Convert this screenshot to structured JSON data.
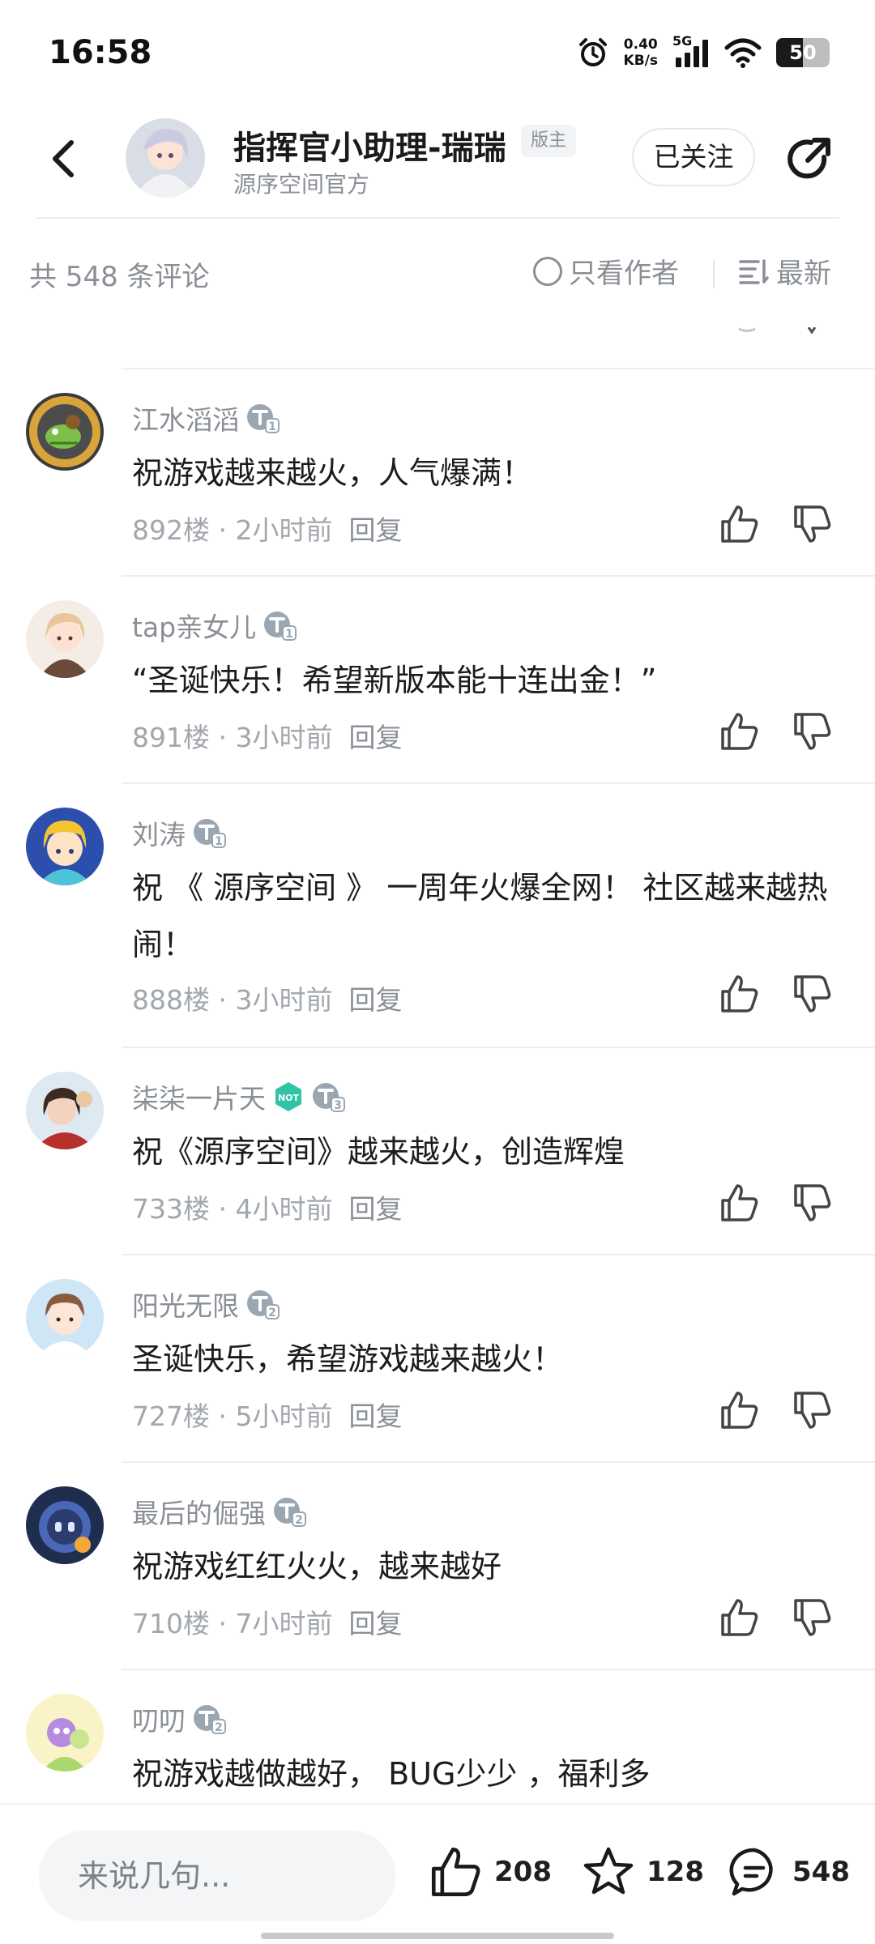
{
  "status_bar": {
    "time": "16:58",
    "net_speed_value": "0.40",
    "net_speed_unit": "KB/s",
    "signal_label": "5G",
    "battery_level": "50",
    "battery_fraction": 0.5,
    "icons": [
      "alarm-icon",
      "signal-icon",
      "wifi-icon",
      "battery-icon"
    ]
  },
  "header": {
    "author_name": "指挥官小助理-瑞瑞",
    "author_badge": "版主",
    "author_subtitle": "源序空间官方",
    "follow_label": "已关注"
  },
  "toolbar": {
    "comment_count": "共 548 条评论",
    "only_author_label": "只看作者",
    "sort_label": "最新"
  },
  "comments": [
    {
      "user": "江水滔滔",
      "level": "1",
      "text": "祝游戏越来越火，人气爆满！",
      "floor": "892楼 · 2小时前",
      "reply": "回复"
    },
    {
      "user": "tap亲女儿",
      "level": "1",
      "text": "“圣诞快乐！希望新版本能十连出金！”",
      "floor": "891楼 · 3小时前",
      "reply": "回复"
    },
    {
      "user": "刘涛",
      "level": "1",
      "text": "祝 《 源序空间 》 一周年火爆全网！ 社区越来越热闹！",
      "floor": "888楼 · 3小时前",
      "reply": "回复"
    },
    {
      "user": "柒柒一片天",
      "level": "3",
      "extra_badge": "NOT",
      "text": "祝《源序空间》越来越火，创造辉煌",
      "floor": "733楼 · 4小时前",
      "reply": "回复"
    },
    {
      "user": "阳光无限",
      "level": "2",
      "text": "圣诞快乐，希望游戏越来越火！",
      "floor": "727楼 · 5小时前",
      "reply": "回复"
    },
    {
      "user": "最后的倔强",
      "level": "2",
      "text": "祝游戏红红火火，越来越好",
      "floor": "710楼 · 7小时前",
      "reply": "回复"
    },
    {
      "user": "叨叨",
      "level": "2",
      "text": "祝游戏越做越好， BUG少少 ，福利多",
      "floor": "",
      "reply": ""
    }
  ],
  "bottom_bar": {
    "input_placeholder": "来说几句...",
    "likes": "208",
    "favorites": "128",
    "comments": "548"
  },
  "colors": {
    "text_primary": "#1c1c1c",
    "text_secondary": "#8a8f96",
    "divider": "#eceef0",
    "level_badge": "#9aa6b2",
    "not_badge": "#2ec4a4"
  }
}
